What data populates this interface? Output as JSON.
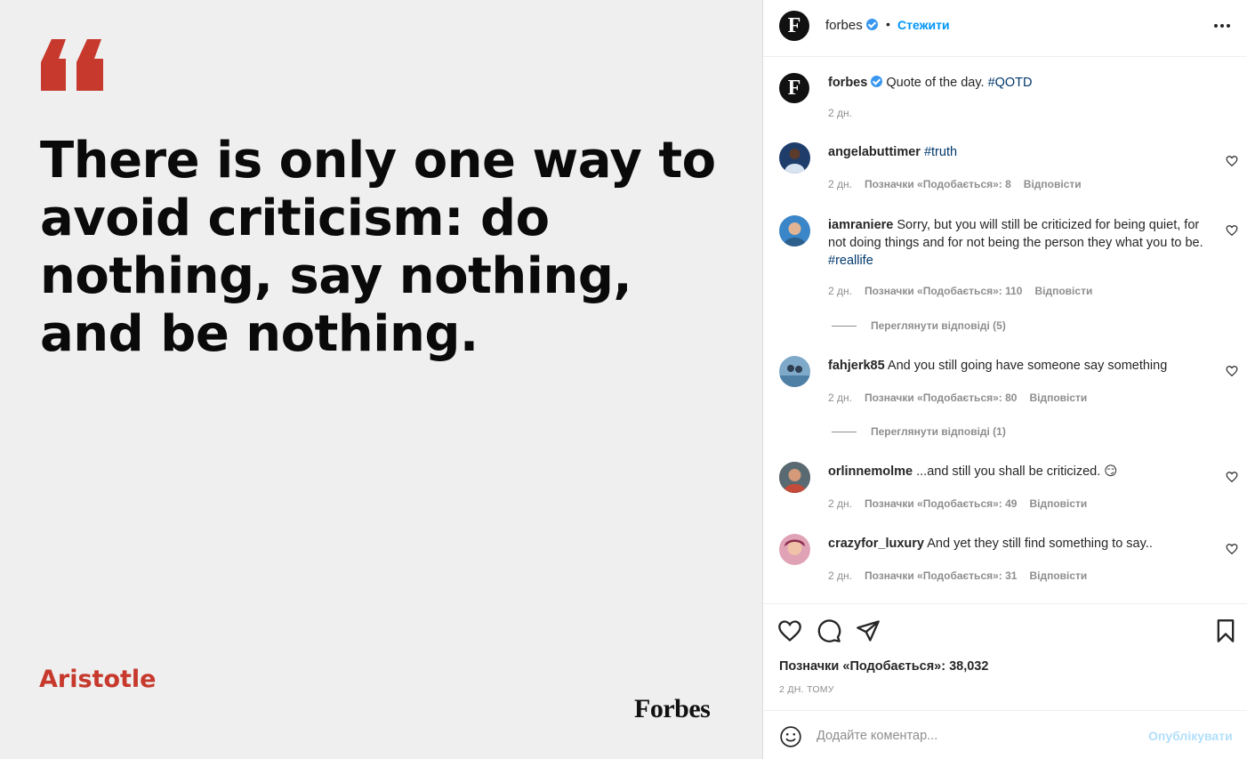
{
  "post_image": {
    "quote": "There is only one way to avoid criticism: do nothing, say nothing, and be nothing.",
    "author": "Aristotle",
    "logo": "Forbes",
    "accent_color": "#c7392d"
  },
  "header": {
    "avatar_letter": "F",
    "username": "forbes",
    "separator": "•",
    "follow_label": "Стежити",
    "more_icon": "more-horizontal-icon"
  },
  "caption": {
    "avatar_letter": "F",
    "username": "forbes",
    "text": "Quote of the day.",
    "hashtag": "#QOTD",
    "time": "2 дн."
  },
  "comments": [
    {
      "username": "angelabuttimer",
      "text": "",
      "hashtag": "#truth",
      "time": "2 дн.",
      "likes": "Позначки «Подобається»: 8",
      "reply": "Відповісти",
      "avatar_color": "#1e3d6b"
    },
    {
      "username": "iamraniere",
      "text": "Sorry, but you will still be criticized for being quiet, for not doing things and for not being the person they what you to be.",
      "hashtag": "#reallife",
      "time": "2 дн.",
      "likes": "Позначки «Подобається»: 110",
      "reply": "Відповісти",
      "view_replies": "Переглянути відповіді (5)",
      "avatar_color": "#3a86c8"
    },
    {
      "username": "fahjerk85",
      "text": "And you still going have someone say something",
      "hashtag": "",
      "time": "2 дн.",
      "likes": "Позначки «Подобається»: 80",
      "reply": "Відповісти",
      "view_replies": "Переглянути відповіді (1)",
      "avatar_color": "#7fa9c9"
    },
    {
      "username": "orlinnemolme",
      "text": "...and still you shall be criticized. 😏",
      "hashtag": "",
      "time": "2 дн.",
      "likes": "Позначки «Подобається»: 49",
      "reply": "Відповісти",
      "avatar_color": "#8a5a44"
    },
    {
      "username": "crazyfor_luxury",
      "text": "And yet they still find something to say..",
      "hashtag": "",
      "time": "2 дн.",
      "likes": "Позначки «Подобається»: 31",
      "reply": "Відповісти",
      "avatar_color": "#e0a3b5"
    }
  ],
  "actions": {
    "like_icon": "heart-icon",
    "comment_icon": "comment-icon",
    "share_icon": "send-icon",
    "save_icon": "bookmark-icon",
    "likes_text": "Позначки «Подобається»: 38,032",
    "time_ago": "2 ДН. ТОМУ"
  },
  "add_comment": {
    "emoji_icon": "emoji-icon",
    "placeholder": "Додайте коментар...",
    "publish_label": "Опублікувати"
  }
}
